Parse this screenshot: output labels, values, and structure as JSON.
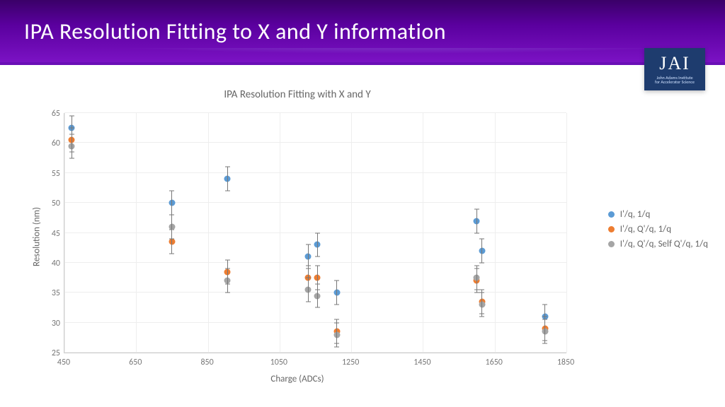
{
  "slide": {
    "title": "IPA Resolution Fitting to X and Y information"
  },
  "logo": {
    "mark": "JAI",
    "sub1": "John Adams Institute",
    "sub2": "for Accelerator Science"
  },
  "chart_data": {
    "type": "scatter",
    "title": "IPA Resolution Fitting with X and Y",
    "xlabel": "Charge (ADCs)",
    "ylabel": "Resolution (nm)",
    "xlim": [
      450,
      1850
    ],
    "ylim": [
      25,
      65
    ],
    "xticks": [
      450,
      650,
      850,
      1050,
      1250,
      1450,
      1650,
      1850
    ],
    "yticks": [
      25,
      30,
      35,
      40,
      45,
      50,
      55,
      60,
      65
    ],
    "error_y": 2.0,
    "series": [
      {
        "name": "I'/q, 1/q",
        "color": "blue",
        "points": [
          {
            "x": 470,
            "y": 62.5
          },
          {
            "x": 750,
            "y": 50.0
          },
          {
            "x": 905,
            "y": 54.0
          },
          {
            "x": 1130,
            "y": 41.0
          },
          {
            "x": 1155,
            "y": 43.0
          },
          {
            "x": 1210,
            "y": 35.0
          },
          {
            "x": 1600,
            "y": 47.0
          },
          {
            "x": 1615,
            "y": 42.0
          },
          {
            "x": 1790,
            "y": 31.0
          }
        ]
      },
      {
        "name": "I'/q, Q'/q, 1/q",
        "color": "orange",
        "points": [
          {
            "x": 470,
            "y": 60.5
          },
          {
            "x": 750,
            "y": 43.5
          },
          {
            "x": 905,
            "y": 38.5
          },
          {
            "x": 1130,
            "y": 37.5
          },
          {
            "x": 1155,
            "y": 37.5
          },
          {
            "x": 1210,
            "y": 28.5
          },
          {
            "x": 1600,
            "y": 37.0
          },
          {
            "x": 1615,
            "y": 33.5
          },
          {
            "x": 1790,
            "y": 29.0
          }
        ]
      },
      {
        "name": "I'/q, Q'/q, Self Q'/q, 1/q",
        "color": "gray",
        "points": [
          {
            "x": 470,
            "y": 59.5
          },
          {
            "x": 750,
            "y": 46.0
          },
          {
            "x": 905,
            "y": 37.0
          },
          {
            "x": 1130,
            "y": 35.5
          },
          {
            "x": 1155,
            "y": 34.5
          },
          {
            "x": 1210,
            "y": 28.0
          },
          {
            "x": 1600,
            "y": 37.5
          },
          {
            "x": 1615,
            "y": 33.0
          },
          {
            "x": 1790,
            "y": 28.5
          }
        ]
      }
    ]
  }
}
